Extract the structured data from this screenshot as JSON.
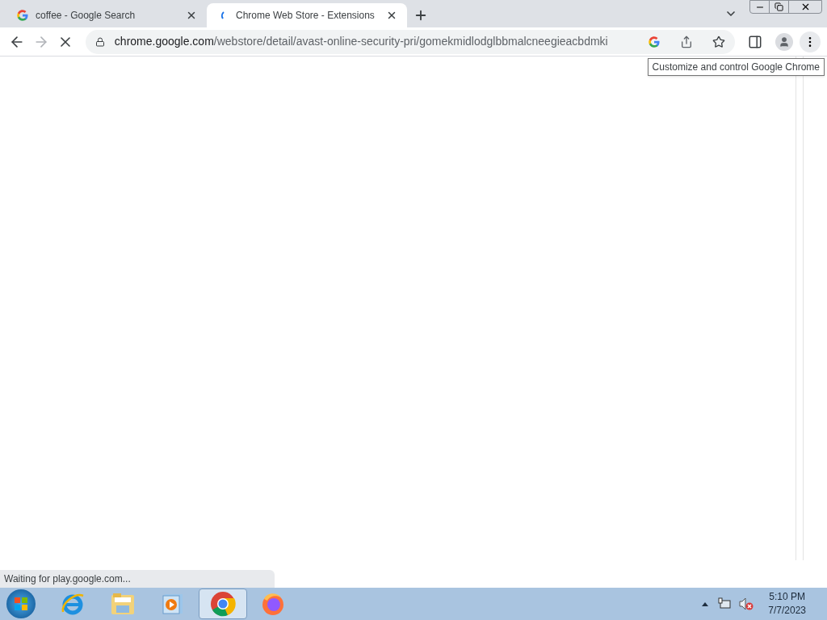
{
  "tabs": [
    {
      "title": "coffee - Google Search",
      "kind": "google",
      "selected": false
    },
    {
      "title": "Chrome Web Store - Extensions",
      "kind": "loading",
      "selected": true
    }
  ],
  "address": {
    "host": "chrome.google.com",
    "path": "/webstore/detail/avast-online-security-pri/gomekmidlodglbbmalcneegieacbdmki"
  },
  "tooltip": "Customize and control Google Chrome",
  "status": "Waiting for play.google.com...",
  "taskbar": {
    "apps": [
      {
        "kind": "ie",
        "selected": false
      },
      {
        "kind": "explorer",
        "selected": false
      },
      {
        "kind": "media",
        "selected": false
      },
      {
        "kind": "chrome",
        "selected": true
      },
      {
        "kind": "firefox",
        "selected": false
      }
    ],
    "time": "5:10 PM",
    "date": "7/7/2023"
  }
}
